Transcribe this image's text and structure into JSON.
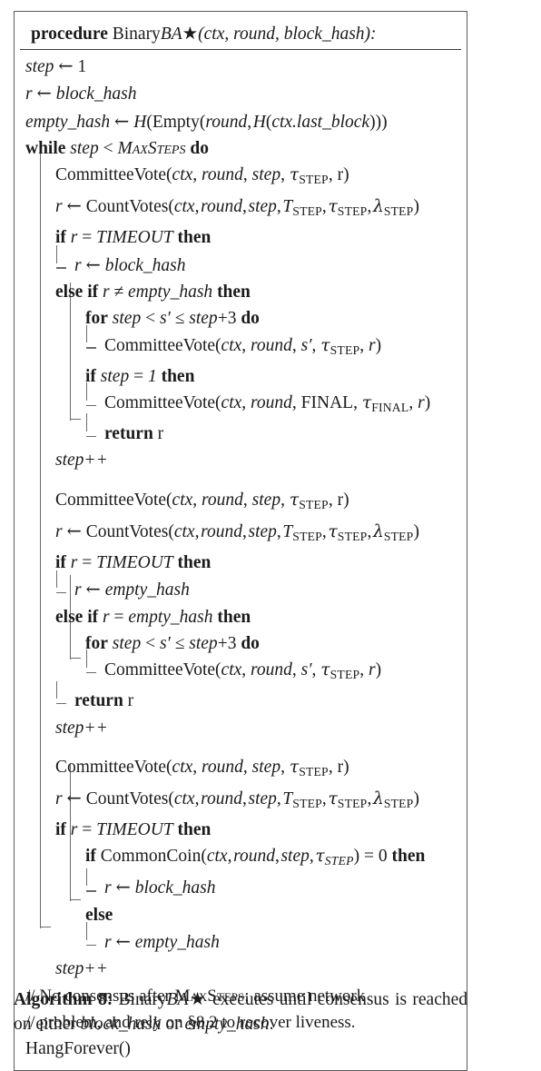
{
  "algorithm": {
    "header": {
      "keyword": "procedure",
      "name_plain": "Binary",
      "name_italic": "BA",
      "star": "★",
      "params": "(ctx, round, block_hash):"
    },
    "lines": [
      {
        "id": "l1",
        "indent": 0,
        "text": "step ← 1"
      },
      {
        "id": "l2",
        "indent": 0,
        "text": "r ← block_hash"
      },
      {
        "id": "l3",
        "indent": 0,
        "text": "empty_hash ← H(Empty(round, H(ctx.last_block)))"
      },
      {
        "id": "l4",
        "indent": 0,
        "text": "while step < MaxSteps do"
      },
      {
        "id": "l5",
        "indent": 1,
        "text": "CommitteeVote(ctx, round, step, τSTEP, r)"
      },
      {
        "id": "l6",
        "indent": 1,
        "text": "r ← CountVotes(ctx, round, step, TSTEP, τSTEP, λSTEP)"
      },
      {
        "id": "l7",
        "indent": 1,
        "text": "if r = TIMEOUT then"
      },
      {
        "id": "l8",
        "indent": 2,
        "text": "r ← block_hash"
      },
      {
        "id": "l9",
        "indent": 1,
        "text": "else if r ≠ empty_hash then"
      },
      {
        "id": "l10",
        "indent": 2,
        "text": "for step < s′ ≤ step + 3 do"
      },
      {
        "id": "l11",
        "indent": 3,
        "text": "CommitteeVote(ctx, round, s′, τSTEP, r)"
      },
      {
        "id": "l12",
        "indent": 2,
        "text": "if step = 1 then"
      },
      {
        "id": "l13",
        "indent": 3,
        "text": "CommitteeVote(ctx, round, FINAL, τFINAL, r)"
      },
      {
        "id": "l14",
        "indent": 2,
        "text": "return r"
      },
      {
        "id": "l15",
        "indent": 1,
        "text": "step++"
      },
      {
        "id": "l16",
        "indent": 1,
        "text": "CommitteeVote(ctx, round, step, τSTEP, r)"
      },
      {
        "id": "l17",
        "indent": 1,
        "text": "r ← CountVotes(ctx, round, step, TSTEP, τSTEP, λSTEP)"
      },
      {
        "id": "l18",
        "indent": 1,
        "text": "if r = TIMEOUT then"
      },
      {
        "id": "l19",
        "indent": 2,
        "text": "r ← empty_hash"
      },
      {
        "id": "l20",
        "indent": 1,
        "text": "else if r = empty_hash then"
      },
      {
        "id": "l21",
        "indent": 2,
        "text": "for step < s′ ≤ step + 3 do"
      },
      {
        "id": "l22",
        "indent": 3,
        "text": "CommitteeVote(ctx, round, s′, τSTEP, r)"
      },
      {
        "id": "l23",
        "indent": 2,
        "text": "return r"
      },
      {
        "id": "l24",
        "indent": 1,
        "text": "step++"
      },
      {
        "id": "l25",
        "indent": 1,
        "text": "CommitteeVote(ctx, round, step, τSTEP, r)"
      },
      {
        "id": "l26",
        "indent": 1,
        "text": "r ← CountVotes(ctx, round, step, TSTEP, τSTEP, λSTEP)"
      },
      {
        "id": "l27",
        "indent": 1,
        "text": "if r = TIMEOUT then"
      },
      {
        "id": "l28",
        "indent": 2,
        "text": "if CommonCoin(ctx, round, step, τSTEP) = 0 then"
      },
      {
        "id": "l29",
        "indent": 3,
        "text": "r ← block_hash"
      },
      {
        "id": "l30",
        "indent": 2,
        "text": "else"
      },
      {
        "id": "l31",
        "indent": 3,
        "text": "r ← empty_hash"
      },
      {
        "id": "l32",
        "indent": 1,
        "text": "step++"
      },
      {
        "id": "l33",
        "indent": 0,
        "text": "// No consensus after MaxSteps; assume network"
      },
      {
        "id": "l34",
        "indent": 0,
        "text": "// problem, and rely on §8.2 to recover liveness."
      },
      {
        "id": "l35",
        "indent": 0,
        "text": "HangForever()"
      }
    ],
    "tokens": {
      "step": "step",
      "r": "r",
      "one": "1",
      "block_hash": "block_hash",
      "empty_hash": "empty_hash",
      "H": "H",
      "Empty": "Empty",
      "round": "round",
      "ctx": "ctx",
      "ctx_last_block": "ctx.last_block",
      "while": "while",
      "do": "do",
      "MaxSteps": "MaxSteps",
      "CommitteeVote": "CommitteeVote",
      "CountVotes": "CountVotes",
      "CommonCoin": "CommonCoin",
      "HangForever": "HangForever()",
      "if": "if",
      "then": "then",
      "else": "else",
      "elseif": "else if",
      "for": "for",
      "return": "return",
      "TIMEOUT": "TIMEOUT",
      "FINAL": "FINAL",
      "STEP": "STEP",
      "FINALSUB": "FINAL",
      "tau": "τ",
      "lambda": "λ",
      "T": "T",
      "arrow": "←",
      "eq": "=",
      "neq": "≠",
      "lt": "<",
      "leq": "≤",
      "plus": "+",
      "three": "3",
      "zero": "0",
      "sprime": "s′",
      "stepinc": "step++",
      "lparen": "(",
      "rparen": ")",
      "comma": ",",
      "slashslash": "//",
      "c_no_consensus": "No consensus after",
      "c_assume": "; assume network",
      "c_problem": "problem, and rely on §8.2 to recover liveness."
    }
  },
  "caption": {
    "label": "Algorithm 8:",
    "part1": "Binary",
    "part2": "BA",
    "star": "★",
    "part3": "executes until consensus is reached on either",
    "block_hash": "block_hash",
    "or": "or",
    "empty_hash": "empty_hash",
    "period": "."
  },
  "colors": {
    "text": "#1b1b1b",
    "frame": "#5a5a5a",
    "rule": "#6b6b6b",
    "background": "#ffffff"
  }
}
